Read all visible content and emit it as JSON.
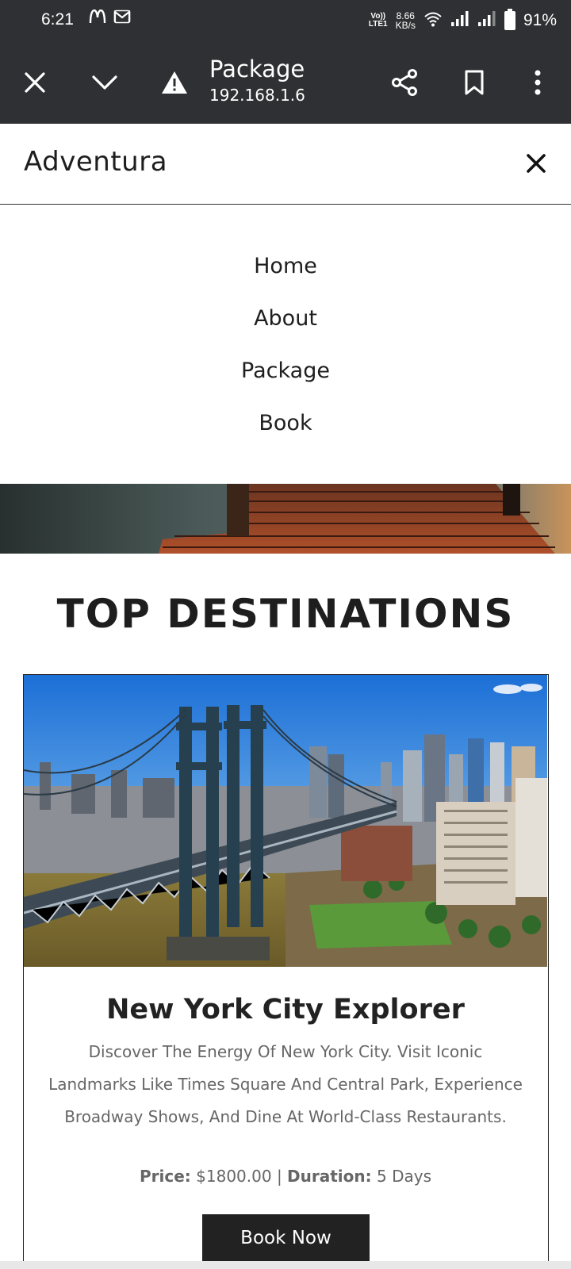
{
  "status_bar": {
    "time": "6:21",
    "notif_icons": [
      "mcdonalds-icon",
      "gmail-icon"
    ],
    "volte_top": "Vo))",
    "volte_bottom": "LTE1",
    "speed_value": "8.66",
    "speed_unit": "KB/s",
    "battery": "91%"
  },
  "browser": {
    "page_title": "Package",
    "host": "192.168.1.6"
  },
  "site": {
    "brand": "Adventura",
    "nav": [
      "Home",
      "About",
      "Package",
      "Book"
    ]
  },
  "section": {
    "title": "TOP DESTINATIONS"
  },
  "card": {
    "title": "New York City Explorer",
    "description": "Discover The Energy Of New York City. Visit Iconic Landmarks Like Times Square And Central Park, Experience Broadway Shows, And Dine At World-Class Restaurants.",
    "price_label": "Price:",
    "price_value": " $1800.00 | ",
    "duration_label": "Duration:",
    "duration_value": " 5 Days",
    "button": "Book Now"
  },
  "colors": {
    "chrome": "#2f3033",
    "text_dark": "#1e1e1e",
    "text_muted": "#666666",
    "button_bg": "#222222"
  }
}
